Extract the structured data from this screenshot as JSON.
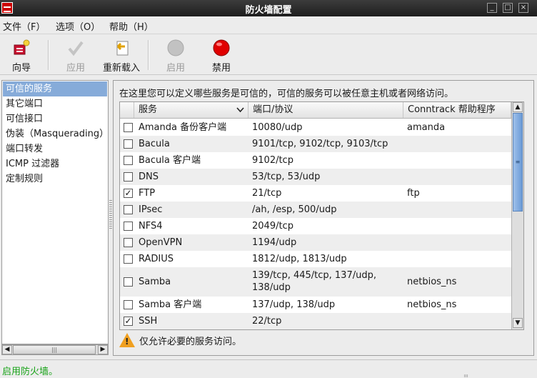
{
  "window": {
    "title": "防火墙配置",
    "min_label": "_",
    "max_label": "□",
    "close_label": "×"
  },
  "menubar": [
    "文件（F）",
    "选项（O）",
    "帮助（H）"
  ],
  "toolbar": {
    "wizard": "向导",
    "apply": "应用",
    "reload": "重新载入",
    "enable": "启用",
    "disable": "禁用"
  },
  "sidebar": {
    "items": [
      "可信的服务",
      "其它端口",
      "可信接口",
      "伪装（Masquerading）",
      "端口转发",
      "ICMP 过滤器",
      "定制规则"
    ],
    "active": "可信的服务"
  },
  "services": {
    "description": "在这里您可以定义哪些服务是可信的，可信的服务可以被任意主机或者网络访问。",
    "columns": {
      "service": "服务",
      "port": "端口/协议",
      "conntrack": "Conntrack 帮助程序"
    },
    "rows": [
      {
        "checked": false,
        "check": "",
        "name": "Amanda 备份客户端",
        "port": "10080/udp",
        "helper": "amanda"
      },
      {
        "checked": false,
        "check": "",
        "name": "Bacula",
        "port": "9101/tcp, 9102/tcp, 9103/tcp",
        "helper": ""
      },
      {
        "checked": false,
        "check": "",
        "name": "Bacula 客户端",
        "port": "9102/tcp",
        "helper": ""
      },
      {
        "checked": false,
        "check": "",
        "name": "DNS",
        "port": "53/tcp, 53/udp",
        "helper": ""
      },
      {
        "checked": true,
        "check": "✓",
        "name": "FTP",
        "port": "21/tcp",
        "helper": "ftp"
      },
      {
        "checked": false,
        "check": "",
        "name": "IPsec",
        "port": "/ah, /esp, 500/udp",
        "helper": ""
      },
      {
        "checked": false,
        "check": "",
        "name": "NFS4",
        "port": "2049/tcp",
        "helper": ""
      },
      {
        "checked": false,
        "check": "",
        "name": "OpenVPN",
        "port": "1194/udp",
        "helper": ""
      },
      {
        "checked": false,
        "check": "",
        "name": "RADIUS",
        "port": "1812/udp, 1813/udp",
        "helper": ""
      },
      {
        "checked": false,
        "check": "",
        "name": "Samba",
        "port": "139/tcp, 445/tcp, 137/udp, 138/udp",
        "helper": "netbios_ns"
      },
      {
        "checked": false,
        "check": "",
        "name": "Samba 客户端",
        "port": "137/udp, 138/udp",
        "helper": "netbios_ns"
      },
      {
        "checked": true,
        "check": "✓",
        "name": "SSH",
        "port": "22/tcp",
        "helper": ""
      }
    ],
    "warning": "仅允许必要的服务访问。"
  },
  "statusbar": {
    "text": "启用防火墙。"
  },
  "colors": {
    "selection": "#86abd9",
    "status_green": "#19a319",
    "disable_red": "#e00000",
    "warning_orange": "#f0a020"
  },
  "icons": {
    "wizard": "wizard-icon",
    "apply": "checkmark-icon",
    "reload": "reload-arrow-icon",
    "enable": "gray-circle-icon",
    "disable": "red-circle-icon",
    "warning": "warning-triangle-icon"
  }
}
